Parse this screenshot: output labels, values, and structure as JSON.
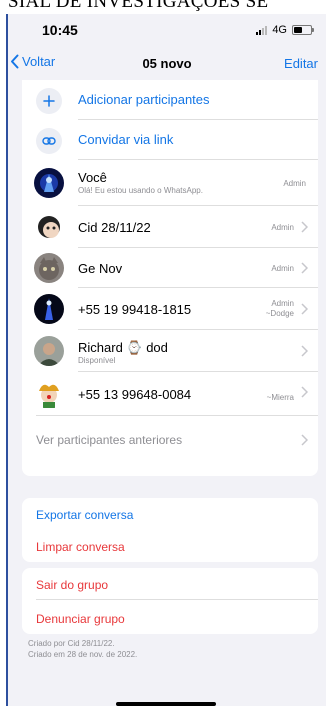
{
  "banner": {
    "text": "SIAL DE INVESTIGAÇÕES SE"
  },
  "status_bar": {
    "time": "10:45",
    "network": "4G"
  },
  "nav": {
    "back_label": "Voltar",
    "title": "05 novo",
    "edit_label": "Editar"
  },
  "actions": {
    "add_participants": "Adicionar participantes",
    "invite_link": "Convidar via link"
  },
  "participants": [
    {
      "name": "Você",
      "status": "Olá! Eu estou usando o WhatsApp.",
      "role": "Admin",
      "subrole": "",
      "avatar_icon": "blue-glow-avatar"
    },
    {
      "name": "Cid 28/11/22",
      "status": "",
      "role": "Admin",
      "subrole": "",
      "avatar_icon": "sticker-avatar"
    },
    {
      "name": "Ge Nov",
      "status": "",
      "role": "Admin",
      "subrole": "",
      "avatar_icon": "cat-avatar"
    },
    {
      "name": "+55 19 99418-1815",
      "status": "",
      "role": "Admin",
      "subrole": "~Dodge",
      "avatar_icon": "night-avatar"
    },
    {
      "name": "Richard ⌚ dod",
      "status": "Disponível",
      "role": "",
      "subrole": "",
      "avatar_icon": "person-avatar"
    },
    {
      "name": "+55 13 99648-0084",
      "status": "",
      "role": "",
      "subrole": "~Mierra",
      "avatar_icon": "clown-avatar"
    }
  ],
  "past_participants": "Ver participantes anteriores",
  "chat_actions": {
    "export": "Exportar conversa",
    "clear": "Limpar conversa"
  },
  "group_actions": {
    "leave": "Sair do grupo",
    "report": "Denunciar grupo"
  },
  "footer": {
    "created_by": "Criado por Cid 28/11/22.",
    "created_on": "Criado em 28 de nov. de 2022."
  },
  "colors": {
    "accent": "#1476e6",
    "destructive": "#e8383b",
    "background": "#f2f2f7"
  }
}
